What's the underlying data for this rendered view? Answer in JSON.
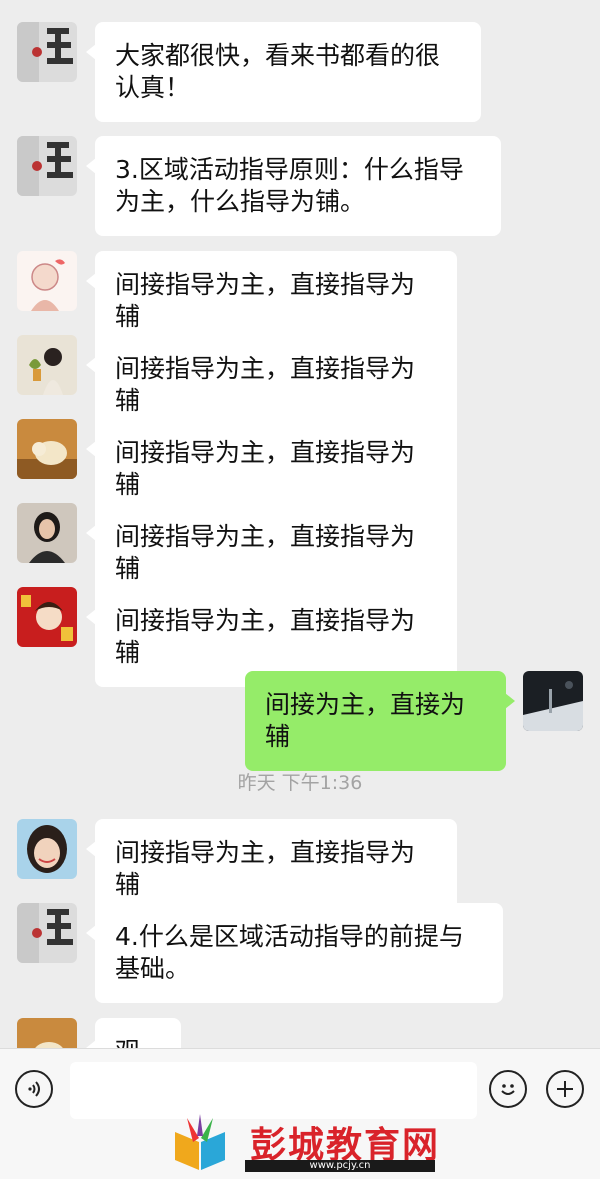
{
  "messages": [
    {
      "side": "left",
      "avatar": "avatar-mask",
      "text": "大家都很快，看来书都看的很认真！"
    },
    {
      "side": "left",
      "avatar": "avatar-mask",
      "text": "3.区域活动指导原则：什么指导为主，什么指导为铺。"
    },
    {
      "side": "left",
      "avatar": "avatar-cartoon-girl",
      "text": "间接指导为主，直接指导为辅"
    },
    {
      "side": "left",
      "avatar": "avatar-girl-plant",
      "text": "间接指导为主，直接指导为辅"
    },
    {
      "side": "left",
      "avatar": "avatar-dog",
      "text": "间接指导为主，直接指导为辅"
    },
    {
      "side": "left",
      "avatar": "avatar-woman-photo",
      "text": "间接指导为主，直接指导为辅"
    },
    {
      "side": "left",
      "avatar": "avatar-red-cartoon",
      "text": "间接指导为主，直接指导为辅"
    },
    {
      "side": "right",
      "avatar": "avatar-snow-scene",
      "text": "间接为主，直接为辅"
    },
    {
      "side": "left",
      "avatar": "avatar-child-photo",
      "text": "间接指导为主，直接指导为辅"
    },
    {
      "side": "left",
      "avatar": "avatar-mask",
      "text": "4.什么是区域活动指导的前提与基础。"
    },
    {
      "side": "left",
      "avatar": "avatar-partial",
      "text": "观察"
    }
  ],
  "timestamp": "昨天 下午1:36",
  "input_bar": {
    "voice_icon": "voice-icon",
    "emoji_icon": "emoji-icon",
    "plus_icon": "plus-icon",
    "input_value": ""
  },
  "watermark": {
    "text": "彭城教育网",
    "sub": "www.pcjy.cn"
  },
  "colors": {
    "background": "#ededed",
    "bubble_self": "#95ec69",
    "bubble_other": "#ffffff",
    "watermark": "#d9232a"
  }
}
